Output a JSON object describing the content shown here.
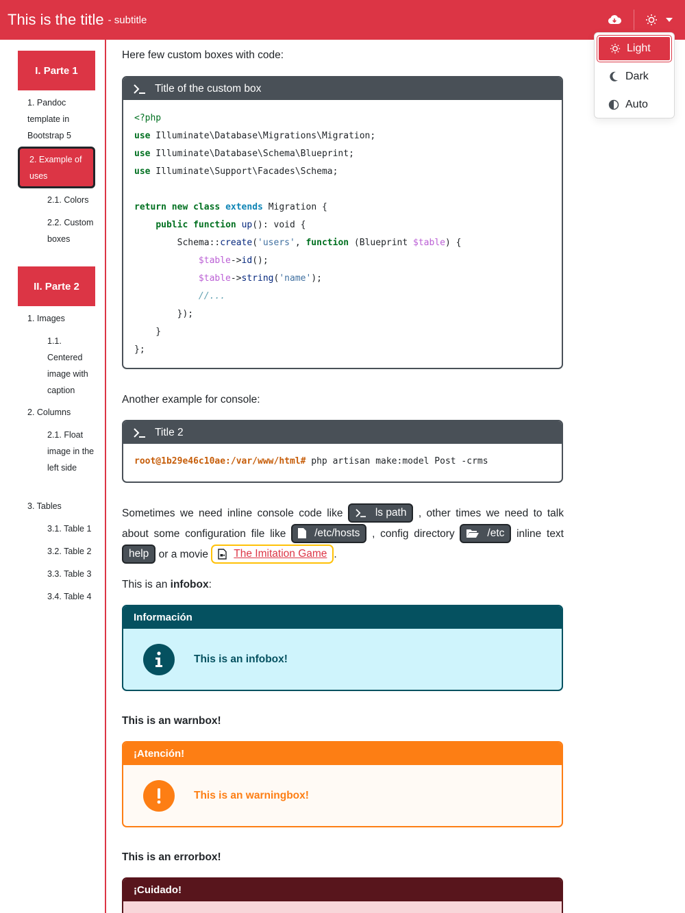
{
  "header": {
    "title": "This is the title",
    "subtitle": "- subtitle"
  },
  "theme_menu": {
    "items": [
      {
        "label": "Light",
        "icon": "sun-icon",
        "active": true
      },
      {
        "label": "Dark",
        "icon": "moon-icon",
        "active": false
      },
      {
        "label": "Auto",
        "icon": "contrast-icon",
        "active": false
      }
    ]
  },
  "sidebar": {
    "part1": "I. Parte 1",
    "item_pandoc": "1. Pandoc template in Bootstrap 5",
    "item_example": "2. Example of uses",
    "item_colors": "2.1. Colors",
    "item_custom": "2.2. Custom boxes",
    "part2": "II. Parte 2",
    "item_images": "1. Images",
    "item_centered": "1.1. Centered image with caption",
    "item_columns": "2. Columns",
    "item_float": "2.1. Float image in the left side",
    "item_tables": "3. Tables",
    "item_table1": "3.1. Table 1",
    "item_table2": "3.2. Table 2",
    "item_table3": "3.3. Table 3",
    "item_table4": "3.4. Table 4"
  },
  "main": {
    "intro": "Here few custom boxes with code:",
    "box1_title": "Title of the custom box",
    "console_intro": "Another example for console:",
    "box2_title": "Title 2",
    "console_prompt": "root@1b29e46c10ae:/var/www/html#",
    "console_cmd": " php artisan make:model Post -crms",
    "inline": {
      "t1": "Sometimes we need inline console code like ",
      "chip_ls": "ls path",
      "t2": " , other times we need to talk about some configuration file like ",
      "chip_hosts": "/etc/hosts",
      "t3": " , config directory ",
      "chip_etc": "/etc",
      "t4": " inline text ",
      "chip_help": "help",
      "t5": " or a movie ",
      "movie": "The Imitation Game",
      "t6": "."
    },
    "infobox_lead_prefix": "This is an ",
    "infobox_lead_bold": "infobox",
    "infobox_lead_suffix": ":",
    "infobox_title": "Información",
    "infobox_text": "This is an infobox!",
    "warnbox_lead": "This is an warnbox!",
    "warnbox_title": "¡Atención!",
    "warnbox_text": "This is an warningbox!",
    "errorbox_lead": "This is an errorbox!",
    "errorbox_title": "¡Cuidado!"
  },
  "colors": {
    "primary": "#dc3545",
    "dark": "#495057",
    "info_head": "#055160",
    "info_bg": "#cff4fc",
    "warn": "#fd7e14",
    "warn_bg": "#fffaf5",
    "error_head": "#58151c",
    "error_bg": "#f8d7da"
  }
}
